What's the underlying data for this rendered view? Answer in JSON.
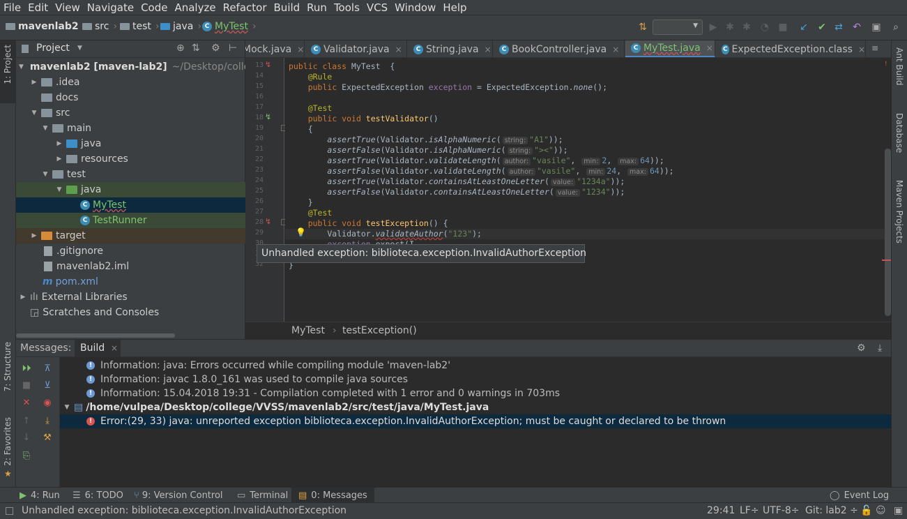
{
  "menu": [
    "File",
    "Edit",
    "View",
    "Navigate",
    "Code",
    "Analyze",
    "Refactor",
    "Build",
    "Run",
    "Tools",
    "VCS",
    "Window",
    "Help"
  ],
  "breadcrumb": [
    "mavenlab2",
    "src",
    "test",
    "java",
    "MyTest"
  ],
  "project_panel": {
    "title": "Project",
    "tree": [
      {
        "label": "mavenlab2 [maven-lab2]",
        "suffix": "~/Desktop/colle"
      },
      {
        "label": ".idea"
      },
      {
        "label": "docs"
      },
      {
        "label": "src"
      },
      {
        "label": "main"
      },
      {
        "label": "java"
      },
      {
        "label": "resources"
      },
      {
        "label": "test"
      },
      {
        "label": "java"
      },
      {
        "label": "MyTest"
      },
      {
        "label": "TestRunner"
      },
      {
        "label": "target"
      },
      {
        "label": ".gitignore"
      },
      {
        "label": "mavenlab2.iml"
      },
      {
        "label": "pom.xml"
      },
      {
        "label": "External Libraries"
      },
      {
        "label": "Scratches and Consoles"
      }
    ]
  },
  "tabs": [
    "Mock.java",
    "Validator.java",
    "String.java",
    "BookController.java",
    "MyTest.java",
    "ExpectedException.class"
  ],
  "line_numbers": [
    "13",
    "14",
    "15",
    "16",
    "17",
    "18",
    "19",
    "20",
    "21",
    "22",
    "23",
    "24",
    "25",
    "26",
    "27",
    "28",
    "29",
    "30",
    "31",
    "32"
  ],
  "tooltip": "Unhandled exception: biblioteca.exception.InvalidAuthorException",
  "editor_breadcrumb": [
    "MyTest",
    "testException()"
  ],
  "messages": {
    "title": "Messages:",
    "tab": "Build",
    "rows": [
      "Information: java: Errors occurred while compiling module 'maven-lab2'",
      "Information: javac 1.8.0_161 was used to compile java sources",
      "Information: 15.04.2018 19:31 - Compilation completed with 1 error and 0 warnings in 703ms",
      "/home/vulpea/Desktop/college/VVSS/mavenlab2/src/test/java/MyTest.java",
      "Error:(29, 33)  java: unreported exception biblioteca.exception.InvalidAuthorException; must be caught or declared to be thrown"
    ]
  },
  "side_tools": {
    "left": [
      "1: Project",
      "7: Structure",
      "2: Favorites"
    ],
    "right": [
      "Ant Build",
      "Database",
      "Maven Projects"
    ]
  },
  "bottom_tabs": [
    "4: Run",
    "6: TODO",
    "9: Version Control",
    "Terminal",
    "0: Messages",
    "Event Log"
  ],
  "status": {
    "message": "Unhandled exception: biblioteca.exception.InvalidAuthorException",
    "position": "29:41",
    "line_sep": "LF÷",
    "encoding": "UTF-8÷",
    "git": "Git: lab2 ÷"
  }
}
